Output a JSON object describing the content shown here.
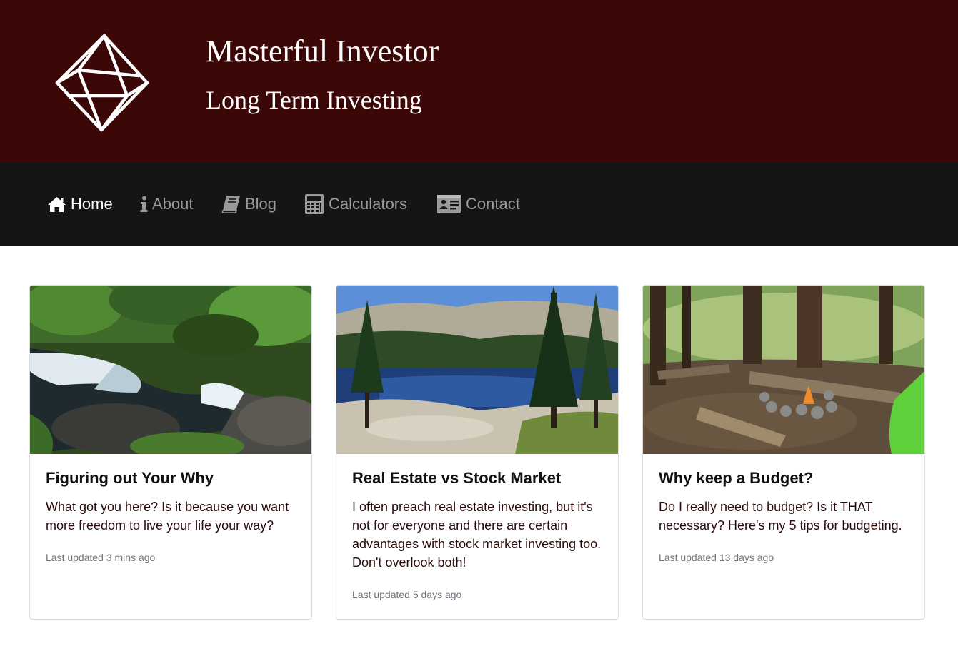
{
  "brand": {
    "title": "Masterful Investor",
    "subtitle": "Long Term Investing",
    "logo_icon": "octahedron-logo-icon",
    "header_color": "#3b0707"
  },
  "nav": {
    "background": "#151515",
    "items": [
      {
        "label": "Home",
        "icon": "home-icon",
        "active": true
      },
      {
        "label": "About",
        "icon": "info-icon",
        "active": false
      },
      {
        "label": "Blog",
        "icon": "book-icon",
        "active": false
      },
      {
        "label": "Calculators",
        "icon": "calculator-icon",
        "active": false
      },
      {
        "label": "Contact",
        "icon": "contact-card-icon",
        "active": false
      }
    ]
  },
  "cards": [
    {
      "title": "Figuring out Your Why",
      "text": "What got you here? Is it because you want more freedom to live your life your way?",
      "meta": "Last updated 3 mins ago",
      "image": "waterfall-photo"
    },
    {
      "title": "Real Estate vs Stock Market",
      "text": "I often preach real estate investing, but it's not for everyone and there are certain advantages with stock market investing too. Don't overlook both!",
      "meta": "Last updated 5 days ago",
      "image": "lake-photo"
    },
    {
      "title": "Why keep a Budget?",
      "text": "Do I really need to budget? Is it THAT necessary? Here's my 5 tips for budgeting.",
      "meta": "Last updated 13 days ago",
      "image": "campfire-photo"
    }
  ]
}
